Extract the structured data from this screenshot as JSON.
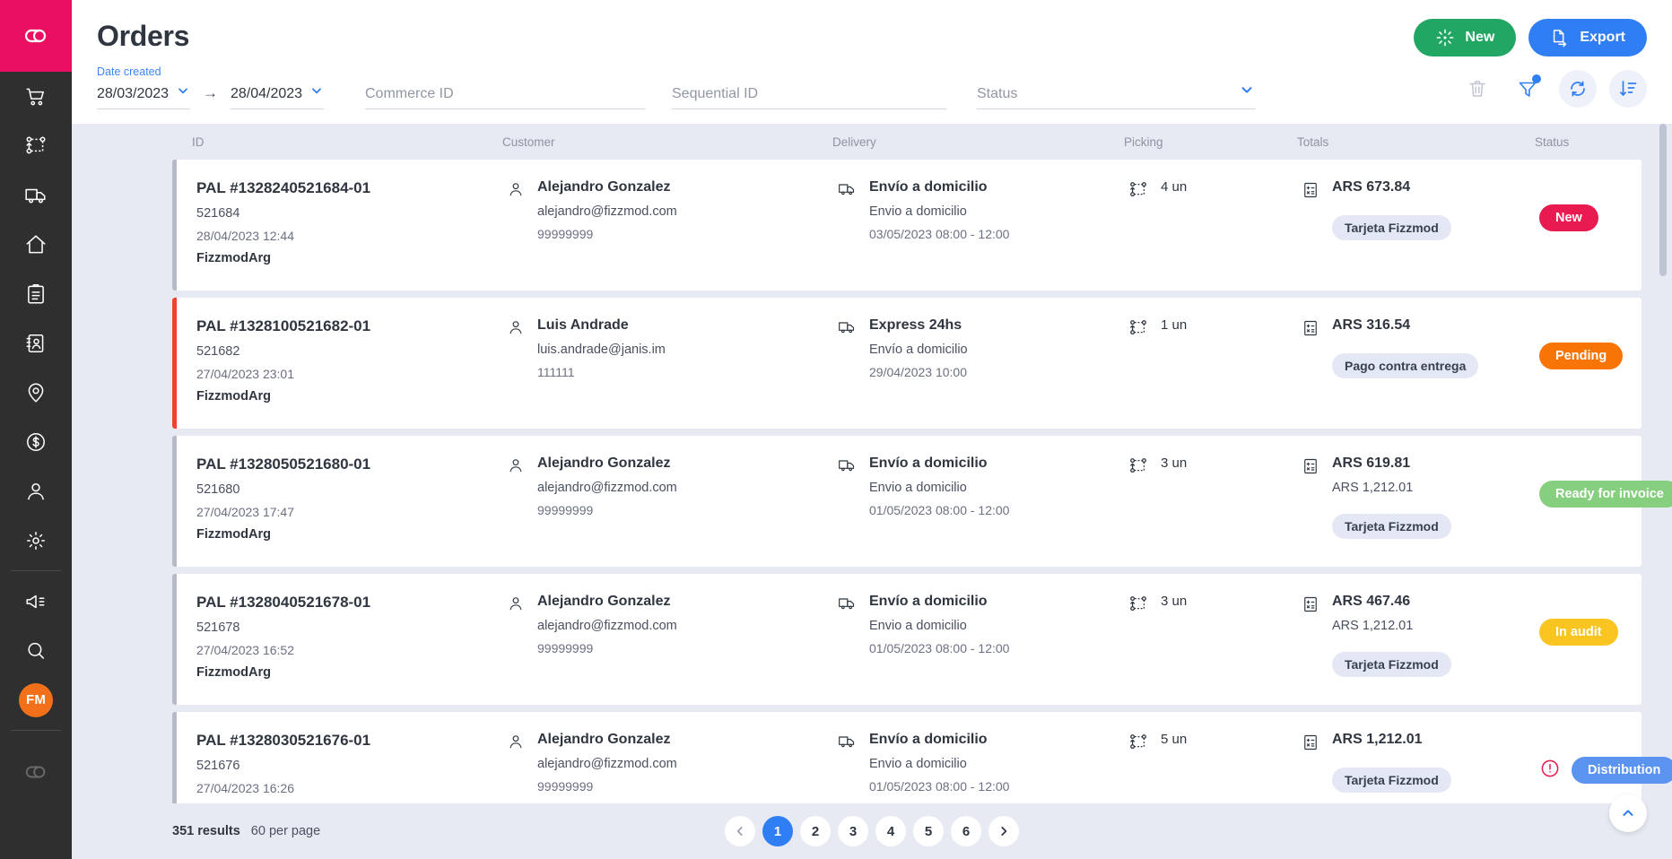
{
  "brand": {
    "logo_icon": "cloud-infinity-logo",
    "color": "#e91063"
  },
  "sidebar": {
    "items": [
      {
        "name": "orders",
        "icon": "shopping-cart-icon"
      },
      {
        "name": "picking",
        "icon": "route-nodes-icon"
      },
      {
        "name": "shipping",
        "icon": "truck-icon"
      },
      {
        "name": "home",
        "icon": "home-icon"
      },
      {
        "name": "tasks",
        "icon": "clipboard-list-icon"
      },
      {
        "name": "contacts",
        "icon": "address-book-icon"
      },
      {
        "name": "locations",
        "icon": "map-pin-icon"
      },
      {
        "name": "billing",
        "icon": "dollar-circle-icon"
      },
      {
        "name": "users",
        "icon": "user-icon"
      },
      {
        "name": "settings",
        "icon": "gear-icon"
      }
    ],
    "secondary": [
      {
        "name": "announcements",
        "icon": "megaphone-icon"
      },
      {
        "name": "search",
        "icon": "search-icon"
      }
    ],
    "avatar_initials": "FM",
    "footer_icon": "cloud-infinity-logo-dim"
  },
  "header": {
    "title": "Orders",
    "new_label": "New",
    "new_icon": "sparkle-icon",
    "new_color": "#22a664",
    "export_label": "Export",
    "export_icon": "file-export-icon",
    "export_color": "#2f7ef3"
  },
  "filters": {
    "date_label": "Date created",
    "date_from": "28/03/2023",
    "date_to": "28/04/2023",
    "range_arrow": "→",
    "commerce_placeholder": "Commerce ID",
    "commerce_value": "",
    "sequential_placeholder": "Sequential ID",
    "sequential_value": "",
    "status_placeholder": "Status",
    "status_value": ""
  },
  "toolbar": {
    "delete_icon": "trash-icon",
    "filter_icon": "funnel-icon",
    "filter_has_badge": true,
    "refresh_icon": "refresh-icon",
    "sort_icon": "sort-descending-icon",
    "accent": "#2f7ef3"
  },
  "table": {
    "columns": [
      "ID",
      "Customer",
      "Delivery",
      "Picking",
      "Totals",
      "Status"
    ],
    "rows": [
      {
        "order_id": "PAL #1328240521684-01",
        "sequential": "521684",
        "date": "28/04/2023 12:44",
        "store": "FizzmodArg",
        "customer_name": "Alejandro Gonzalez",
        "customer_email": "alejandro@fizzmod.com",
        "customer_doc": "99999999",
        "delivery_type": "Envío a domicilio",
        "delivery_sub": "Envio a domicilio",
        "delivery_window": "03/05/2023 08:00 - 12:00",
        "picking": "4 un",
        "total": "ARS 673.84",
        "total_secondary": "",
        "payment": "Tarjeta Fizzmod",
        "status": "New",
        "status_class": "new",
        "accent": "normal",
        "has_alert": false
      },
      {
        "order_id": "PAL #1328100521682-01",
        "sequential": "521682",
        "date": "27/04/2023 23:01",
        "store": "FizzmodArg",
        "customer_name": "Luis Andrade",
        "customer_email": "luis.andrade@janis.im",
        "customer_doc": "111111",
        "delivery_type": "Express 24hs",
        "delivery_sub": "Envío a domicilio",
        "delivery_window": "29/04/2023 10:00",
        "picking": "1 un",
        "total": "ARS 316.54",
        "total_secondary": "",
        "payment": "Pago contra entrega",
        "status": "Pending",
        "status_class": "pending",
        "accent": "red",
        "has_alert": false
      },
      {
        "order_id": "PAL #1328050521680-01",
        "sequential": "521680",
        "date": "27/04/2023 17:47",
        "store": "FizzmodArg",
        "customer_name": "Alejandro Gonzalez",
        "customer_email": "alejandro@fizzmod.com",
        "customer_doc": "99999999",
        "delivery_type": "Envío a domicilio",
        "delivery_sub": "Envio a domicilio",
        "delivery_window": "01/05/2023 08:00 - 12:00",
        "picking": "3 un",
        "total": "ARS 619.81",
        "total_secondary": "ARS 1,212.01",
        "payment": "Tarjeta Fizzmod",
        "status": "Ready for invoice",
        "status_class": "ready",
        "accent": "normal",
        "has_alert": false
      },
      {
        "order_id": "PAL #1328040521678-01",
        "sequential": "521678",
        "date": "27/04/2023 16:52",
        "store": "FizzmodArg",
        "customer_name": "Alejandro Gonzalez",
        "customer_email": "alejandro@fizzmod.com",
        "customer_doc": "99999999",
        "delivery_type": "Envío a domicilio",
        "delivery_sub": "Envio a domicilio",
        "delivery_window": "01/05/2023 08:00 - 12:00",
        "picking": "3 un",
        "total": "ARS 467.46",
        "total_secondary": "ARS 1,212.01",
        "payment": "Tarjeta Fizzmod",
        "status": "In audit",
        "status_class": "audit",
        "accent": "normal",
        "has_alert": false
      },
      {
        "order_id": "PAL #1328030521676-01",
        "sequential": "521676",
        "date": "27/04/2023 16:26",
        "store": "",
        "customer_name": "Alejandro Gonzalez",
        "customer_email": "alejandro@fizzmod.com",
        "customer_doc": "99999999",
        "delivery_type": "Envío a domicilio",
        "delivery_sub": "Envio a domicilio",
        "delivery_window": "01/05/2023 08:00 - 12:00",
        "picking": "5 un",
        "total": "ARS 1,212.01",
        "total_secondary": "",
        "payment": "Tarjeta Fizzmod",
        "status": "Distribution",
        "status_class": "dist",
        "accent": "normal",
        "has_alert": true
      }
    ]
  },
  "footer": {
    "results": "351 results",
    "per_page": "60 per page",
    "prev_icon": "chevron-left-icon",
    "next_icon": "chevron-right-icon",
    "pages": [
      "1",
      "2",
      "3",
      "4",
      "5",
      "6"
    ],
    "active_page": "1",
    "to_top_icon": "chevron-up-icon"
  }
}
